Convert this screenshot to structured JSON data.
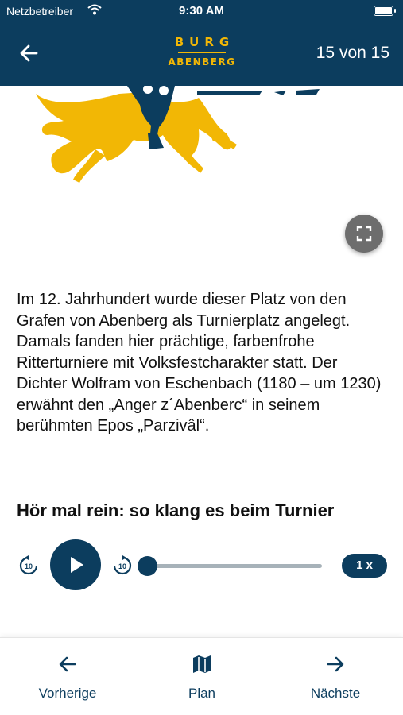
{
  "status_bar": {
    "carrier": "Netzbetreiber",
    "time": "9:30 AM",
    "wifi_icon": "wifi-icon",
    "battery_icon": "battery-icon"
  },
  "header": {
    "back_icon": "arrow-left-icon",
    "logo_top": "BURG",
    "logo_bottom": "ABENBERG",
    "page_counter": "15 von 15"
  },
  "content": {
    "image_name": "knight-on-yellow-horse-illustration",
    "fullscreen_icon": "expand-icon",
    "description": "Im 12. Jahrhundert wurde dieser Platz von den Grafen von Abenberg als Turnierplatz angelegt. Damals fanden hier prächtige, farbenfrohe Ritterturniere mit Volksfestcharakter statt. Der Dichter Wolfram von Eschenbach (1180 – um 1230) erwähnt den „Anger z´Abenberc“ in seinem berühmten Epos „Parzivâl“.",
    "audio_title": "Hör mal rein: so klang es beim Turnier"
  },
  "player": {
    "rewind_label": "10",
    "forward_label": "10",
    "progress": 0,
    "speed": "1 x"
  },
  "bottom_nav": {
    "prev_label": "Vorherige",
    "plan_label": "Plan",
    "next_label": "Nächste"
  },
  "colors": {
    "primary": "#0c3d5e",
    "accent": "#f2b705"
  }
}
